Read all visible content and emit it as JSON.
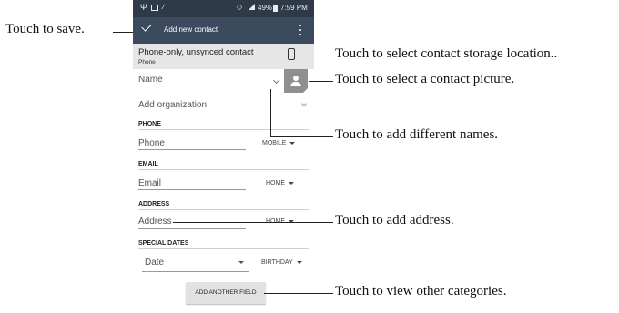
{
  "status_bar": {
    "status_text": "49%",
    "time": "7:59 PM"
  },
  "app_bar": {
    "title": "Add new contact"
  },
  "account": {
    "title": "Phone-only, unsynced contact",
    "subtitle": "Phone"
  },
  "form": {
    "name_placeholder": "Name",
    "org_placeholder": "Add organization",
    "phone_section": "PHONE",
    "phone_placeholder": "Phone",
    "phone_type": "MOBILE",
    "email_section": "EMAIL",
    "email_placeholder": "Email",
    "email_type": "HOME",
    "address_section": "ADDRESS",
    "address_placeholder": "Address",
    "address_type": "HOME",
    "dates_section": "SPECIAL DATES",
    "date_placeholder": "Date",
    "date_type": "BIRTHDAY",
    "add_field_button": "ADD ANOTHER FIELD"
  },
  "annotations": {
    "save": "Touch to save.",
    "storage": "Touch to select contact storage location..",
    "picture": "Touch to select a contact picture.",
    "names": "Touch to add different names.",
    "address": "Touch to add address.",
    "categories": "Touch to view other categories."
  },
  "colors": {
    "status_bar": "#2f3a48",
    "app_bar": "#3b4a5c",
    "account_bg": "#e6e6e6",
    "photo_bg": "#8f8f8f"
  },
  "icons": [
    "check-icon",
    "overflow-menu-icon",
    "phone-device-icon",
    "person-icon",
    "chevron-down-icon",
    "dropdown-arrow-icon"
  ]
}
